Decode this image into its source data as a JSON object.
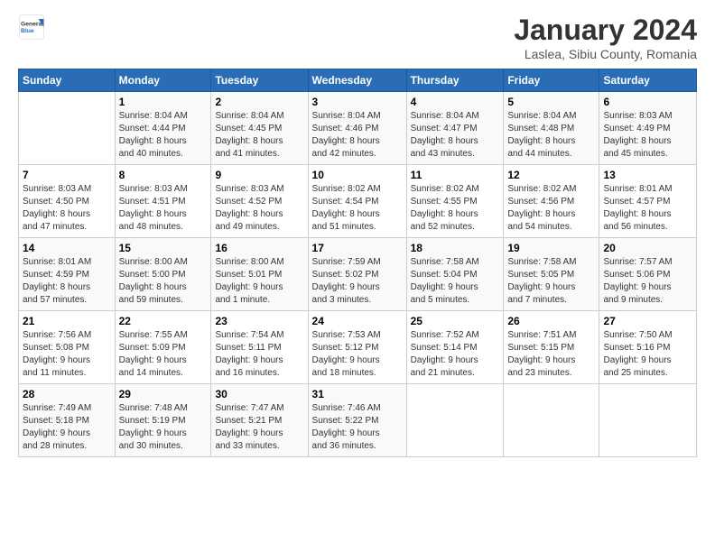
{
  "header": {
    "logo_line1": "General",
    "logo_line2": "Blue",
    "title": "January 2024",
    "location": "Laslea, Sibiu County, Romania"
  },
  "calendar": {
    "weekdays": [
      "Sunday",
      "Monday",
      "Tuesday",
      "Wednesday",
      "Thursday",
      "Friday",
      "Saturday"
    ],
    "weeks": [
      [
        {
          "day": "",
          "info": ""
        },
        {
          "day": "1",
          "info": "Sunrise: 8:04 AM\nSunset: 4:44 PM\nDaylight: 8 hours\nand 40 minutes."
        },
        {
          "day": "2",
          "info": "Sunrise: 8:04 AM\nSunset: 4:45 PM\nDaylight: 8 hours\nand 41 minutes."
        },
        {
          "day": "3",
          "info": "Sunrise: 8:04 AM\nSunset: 4:46 PM\nDaylight: 8 hours\nand 42 minutes."
        },
        {
          "day": "4",
          "info": "Sunrise: 8:04 AM\nSunset: 4:47 PM\nDaylight: 8 hours\nand 43 minutes."
        },
        {
          "day": "5",
          "info": "Sunrise: 8:04 AM\nSunset: 4:48 PM\nDaylight: 8 hours\nand 44 minutes."
        },
        {
          "day": "6",
          "info": "Sunrise: 8:03 AM\nSunset: 4:49 PM\nDaylight: 8 hours\nand 45 minutes."
        }
      ],
      [
        {
          "day": "7",
          "info": "Sunrise: 8:03 AM\nSunset: 4:50 PM\nDaylight: 8 hours\nand 47 minutes."
        },
        {
          "day": "8",
          "info": "Sunrise: 8:03 AM\nSunset: 4:51 PM\nDaylight: 8 hours\nand 48 minutes."
        },
        {
          "day": "9",
          "info": "Sunrise: 8:03 AM\nSunset: 4:52 PM\nDaylight: 8 hours\nand 49 minutes."
        },
        {
          "day": "10",
          "info": "Sunrise: 8:02 AM\nSunset: 4:54 PM\nDaylight: 8 hours\nand 51 minutes."
        },
        {
          "day": "11",
          "info": "Sunrise: 8:02 AM\nSunset: 4:55 PM\nDaylight: 8 hours\nand 52 minutes."
        },
        {
          "day": "12",
          "info": "Sunrise: 8:02 AM\nSunset: 4:56 PM\nDaylight: 8 hours\nand 54 minutes."
        },
        {
          "day": "13",
          "info": "Sunrise: 8:01 AM\nSunset: 4:57 PM\nDaylight: 8 hours\nand 56 minutes."
        }
      ],
      [
        {
          "day": "14",
          "info": "Sunrise: 8:01 AM\nSunset: 4:59 PM\nDaylight: 8 hours\nand 57 minutes."
        },
        {
          "day": "15",
          "info": "Sunrise: 8:00 AM\nSunset: 5:00 PM\nDaylight: 8 hours\nand 59 minutes."
        },
        {
          "day": "16",
          "info": "Sunrise: 8:00 AM\nSunset: 5:01 PM\nDaylight: 9 hours\nand 1 minute."
        },
        {
          "day": "17",
          "info": "Sunrise: 7:59 AM\nSunset: 5:02 PM\nDaylight: 9 hours\nand 3 minutes."
        },
        {
          "day": "18",
          "info": "Sunrise: 7:58 AM\nSunset: 5:04 PM\nDaylight: 9 hours\nand 5 minutes."
        },
        {
          "day": "19",
          "info": "Sunrise: 7:58 AM\nSunset: 5:05 PM\nDaylight: 9 hours\nand 7 minutes."
        },
        {
          "day": "20",
          "info": "Sunrise: 7:57 AM\nSunset: 5:06 PM\nDaylight: 9 hours\nand 9 minutes."
        }
      ],
      [
        {
          "day": "21",
          "info": "Sunrise: 7:56 AM\nSunset: 5:08 PM\nDaylight: 9 hours\nand 11 minutes."
        },
        {
          "day": "22",
          "info": "Sunrise: 7:55 AM\nSunset: 5:09 PM\nDaylight: 9 hours\nand 14 minutes."
        },
        {
          "day": "23",
          "info": "Sunrise: 7:54 AM\nSunset: 5:11 PM\nDaylight: 9 hours\nand 16 minutes."
        },
        {
          "day": "24",
          "info": "Sunrise: 7:53 AM\nSunset: 5:12 PM\nDaylight: 9 hours\nand 18 minutes."
        },
        {
          "day": "25",
          "info": "Sunrise: 7:52 AM\nSunset: 5:14 PM\nDaylight: 9 hours\nand 21 minutes."
        },
        {
          "day": "26",
          "info": "Sunrise: 7:51 AM\nSunset: 5:15 PM\nDaylight: 9 hours\nand 23 minutes."
        },
        {
          "day": "27",
          "info": "Sunrise: 7:50 AM\nSunset: 5:16 PM\nDaylight: 9 hours\nand 25 minutes."
        }
      ],
      [
        {
          "day": "28",
          "info": "Sunrise: 7:49 AM\nSunset: 5:18 PM\nDaylight: 9 hours\nand 28 minutes."
        },
        {
          "day": "29",
          "info": "Sunrise: 7:48 AM\nSunset: 5:19 PM\nDaylight: 9 hours\nand 30 minutes."
        },
        {
          "day": "30",
          "info": "Sunrise: 7:47 AM\nSunset: 5:21 PM\nDaylight: 9 hours\nand 33 minutes."
        },
        {
          "day": "31",
          "info": "Sunrise: 7:46 AM\nSunset: 5:22 PM\nDaylight: 9 hours\nand 36 minutes."
        },
        {
          "day": "",
          "info": ""
        },
        {
          "day": "",
          "info": ""
        },
        {
          "day": "",
          "info": ""
        }
      ]
    ]
  }
}
